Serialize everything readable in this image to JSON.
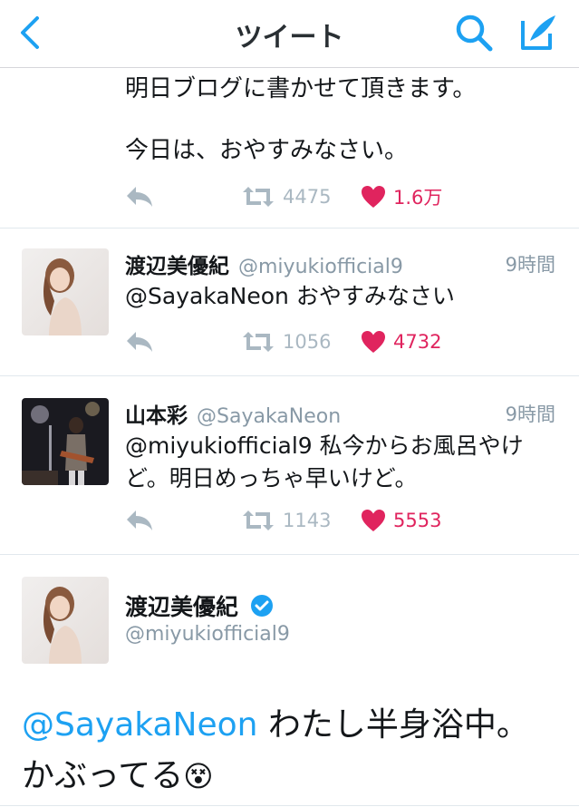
{
  "nav": {
    "title": "ツイート"
  },
  "fragment": {
    "line1": "明日ブログに書かせて頂きます。",
    "line2": "今日は、おやすみなさい。",
    "retweets": "4475",
    "likes": "1.6万"
  },
  "reply1": {
    "name": "渡辺美優紀",
    "handle": "@miyukiofficial9",
    "time": "9時間",
    "text": "@SayakaNeon おやすみなさい",
    "retweets": "1056",
    "likes": "4732"
  },
  "reply2": {
    "name": "山本彩",
    "handle": "@SayakaNeon",
    "time": "9時間",
    "text_line1": "@miyukiofficial9 私今からお風呂やけ",
    "text_line2": "ど。明日めっちゃ早いけど。",
    "retweets": "1143",
    "likes": "5553"
  },
  "main": {
    "name": "渡辺美優紀",
    "handle": "@miyukiofficial9",
    "mention": "@SayakaNeon",
    "text_after_mention": " わたし半身浴中。",
    "text_line2": "かぶってる",
    "emoji": "😵"
  },
  "colors": {
    "accent": "#1da1f2",
    "like": "#e0245e",
    "muted": "#8899a6"
  },
  "icons": [
    "back-chevron-icon",
    "search-icon",
    "compose-icon",
    "reply-icon",
    "retweet-icon",
    "heart-icon",
    "verified-icon"
  ]
}
